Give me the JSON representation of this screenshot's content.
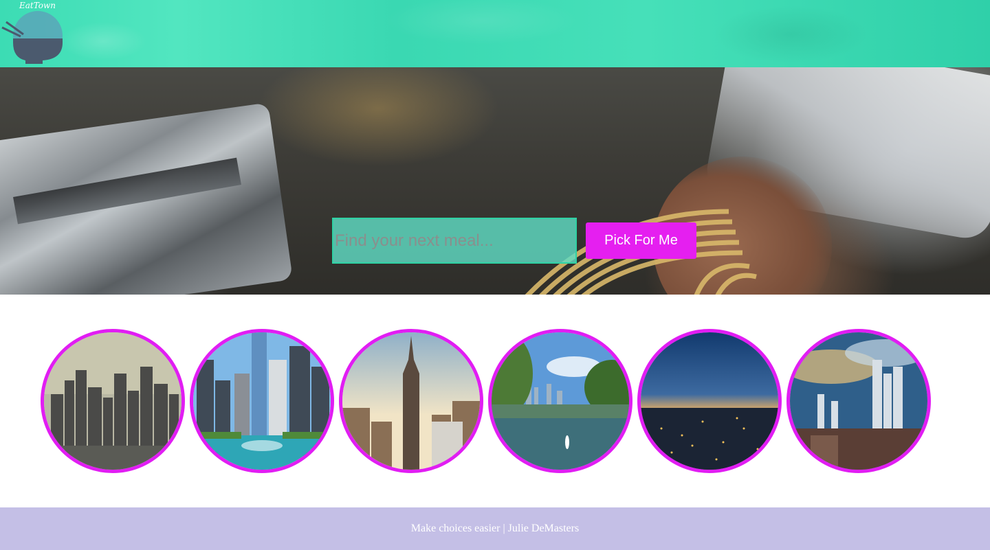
{
  "header": {
    "logo_text": "EatTown"
  },
  "hero": {
    "search_placeholder": "Find your next meal...",
    "search_value": "",
    "pick_button_label": "Pick For Me"
  },
  "cities": [
    {
      "name": "city-image-1"
    },
    {
      "name": "city-image-2"
    },
    {
      "name": "city-image-3"
    },
    {
      "name": "city-image-4"
    },
    {
      "name": "city-image-5"
    },
    {
      "name": "city-image-6"
    }
  ],
  "footer": {
    "text": "Make choices easier | Julie DeMasters"
  },
  "colors": {
    "header_teal": "#3cdcb4",
    "accent_magenta": "#e51ff0",
    "footer_lavender": "#c4bfe6"
  }
}
